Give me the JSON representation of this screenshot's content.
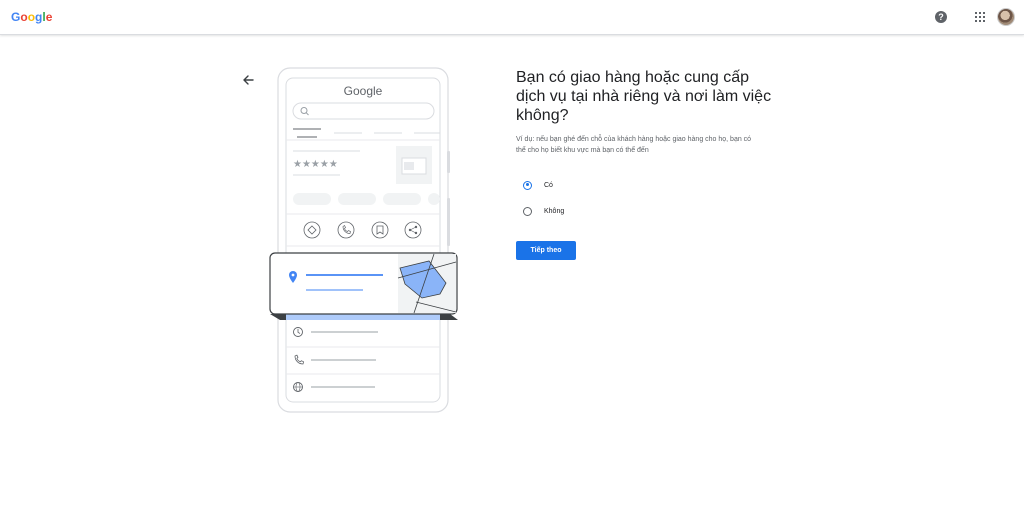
{
  "header": {
    "logo_letters": [
      "G",
      "o",
      "o",
      "g",
      "l",
      "e"
    ],
    "logo_colors": [
      "#4285F4",
      "#EA4335",
      "#FBBC05",
      "#4285F4",
      "#34A853",
      "#EA4335"
    ],
    "help_glyph": "?"
  },
  "illustration": {
    "brand": "Google"
  },
  "main": {
    "title": "Bạn có giao hàng hoặc cung cấp dịch vụ tại nhà riêng và nơi làm việc không?",
    "subtitle": "Ví dụ: nếu bạn ghé đến chỗ của khách hàng hoặc giao hàng cho họ, bạn có thể cho họ biết khu vực mà bạn có thể đến",
    "options": [
      {
        "label": "Có",
        "selected": true
      },
      {
        "label": "Không",
        "selected": false
      }
    ],
    "next_label": "Tiếp theo"
  },
  "colors": {
    "accent": "#1a73e8",
    "map_area": "#8ab4f8"
  },
  "icons": [
    "back-arrow-icon",
    "help-icon",
    "apps-grid-icon",
    "search-icon",
    "store-icon",
    "directions-icon",
    "call-icon",
    "bookmark-icon",
    "share-icon",
    "location-pin-icon",
    "clock-icon",
    "phone-icon",
    "globe-icon"
  ]
}
